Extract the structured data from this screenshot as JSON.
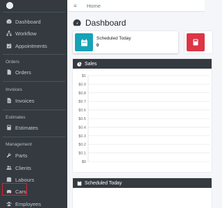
{
  "sidebar": {
    "items": [
      {
        "label": "Dashboard",
        "icon": "gauge-icon"
      },
      {
        "label": "Workflow",
        "icon": "sitemap-icon"
      },
      {
        "label": "Appointments",
        "icon": "calendar-check-icon"
      }
    ],
    "sections": [
      {
        "header": "Orders",
        "item": {
          "label": "Orders",
          "icon": "file-icon"
        }
      },
      {
        "header": "Invoices",
        "item": {
          "label": "Invoices",
          "icon": "file-alt-icon"
        }
      },
      {
        "header": "Estimates",
        "item": {
          "label": "Estimates",
          "icon": "calculator-icon"
        }
      }
    ],
    "management": {
      "header": "Management",
      "items": [
        {
          "label": "Parts",
          "icon": "wrench-icon"
        },
        {
          "label": "Clients",
          "icon": "users-icon"
        },
        {
          "label": "Labours",
          "icon": "box-icon"
        },
        {
          "label": "Cars",
          "icon": "car-icon"
        },
        {
          "label": "Employees",
          "icon": "user-group-icon"
        }
      ]
    }
  },
  "topbar": {
    "menu_icon": "≡",
    "breadcrumb": "Home"
  },
  "page": {
    "title": "Dashboard"
  },
  "stats": {
    "label": "Scheduled Today",
    "value": "0",
    "color": "#17a2b8",
    "second_color": "#dc3545"
  },
  "sales_card": {
    "title": "Sales"
  },
  "schedule_card": {
    "title": "Scheduled Today"
  },
  "chart_data": {
    "type": "line",
    "title": "",
    "yticks": [
      "$1",
      "$0.9",
      "$0.8",
      "$0.7",
      "$0.6",
      "$0.5",
      "$0.4",
      "$0.3",
      "$0.2",
      "$0.1",
      "$0"
    ],
    "ylim": [
      0,
      1
    ],
    "grid": true,
    "series": []
  },
  "colors": {
    "sidebar_bg": "#343a40",
    "highlight": "#e0212b"
  }
}
